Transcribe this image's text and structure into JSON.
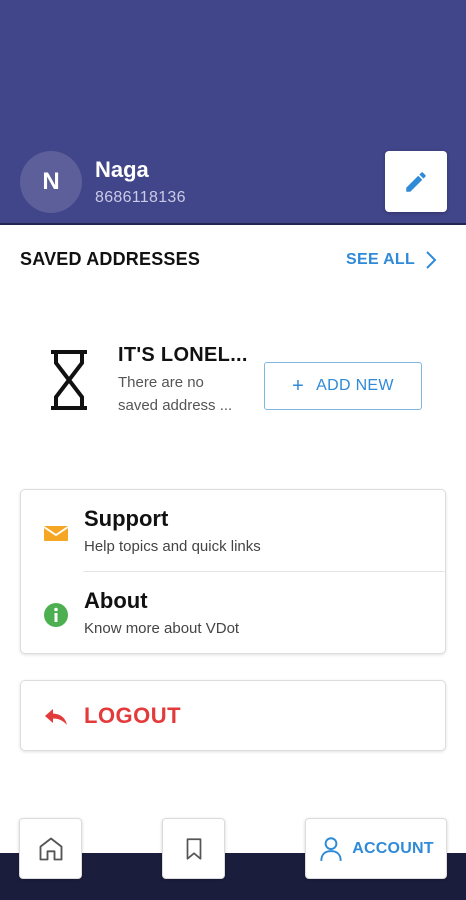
{
  "profile": {
    "initial": "N",
    "name": "Naga",
    "phone": "8686118136"
  },
  "addresses": {
    "title": "SAVED ADDRESSES",
    "see_all": "SEE ALL",
    "empty_title": "IT'S LONEL...",
    "empty_line1": "There are no",
    "empty_line2": "saved address ...",
    "add_new": "ADD NEW"
  },
  "menu": {
    "support_title": "Support",
    "support_sub": "Help topics and quick links",
    "about_title": "About",
    "about_sub": "Know more about VDot",
    "logout": "LOGOUT"
  },
  "nav": {
    "account_label": "ACCOUNT"
  },
  "colors": {
    "header": "#414589",
    "accent": "#2f8ad8",
    "logout": "#e33b3b",
    "support_icon": "#f5a623",
    "about_icon": "#4caf50"
  },
  "icons": [
    "pencil-icon",
    "chevron-right-icon",
    "hourglass-icon",
    "plus-icon",
    "mail-icon",
    "info-icon",
    "reply-arrow-icon",
    "home-icon",
    "bookmark-icon",
    "user-icon"
  ]
}
